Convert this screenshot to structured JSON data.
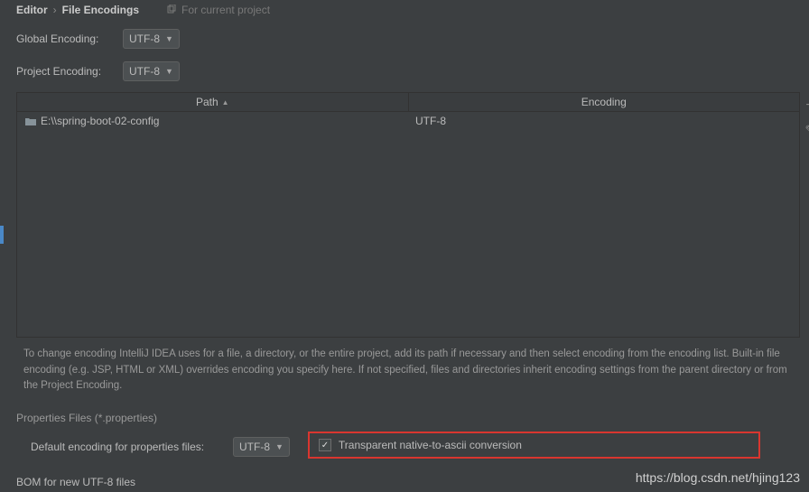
{
  "breadcrumb": {
    "item1": "Editor",
    "item2": "File Encodings"
  },
  "projectHint": "For current project",
  "globalEncoding": {
    "label": "Global Encoding:",
    "value": "UTF-8"
  },
  "projectEncoding": {
    "label": "Project Encoding:",
    "value": "UTF-8"
  },
  "table": {
    "headers": {
      "path": "Path",
      "encoding": "Encoding"
    },
    "rows": [
      {
        "path": "E:\\\\spring-boot-02-config",
        "encoding": "UTF-8"
      }
    ]
  },
  "description": "To change encoding IntelliJ IDEA uses for a file, a directory, or the entire project, add its path if necessary and then select encoding from the encoding list. Built-in file encoding (e.g. JSP, HTML or XML) overrides encoding you specify here. If not specified, files and directories inherit encoding settings from the parent directory or from the Project Encoding.",
  "propertiesSection": {
    "title": "Properties Files (*.properties)",
    "defaultLabel": "Default encoding for properties files:",
    "defaultValue": "UTF-8",
    "checkboxLabel": "Transparent native-to-ascii conversion"
  },
  "bomLabel": "BOM for new UTF-8 files",
  "watermark": "https://blog.csdn.net/hjing123"
}
